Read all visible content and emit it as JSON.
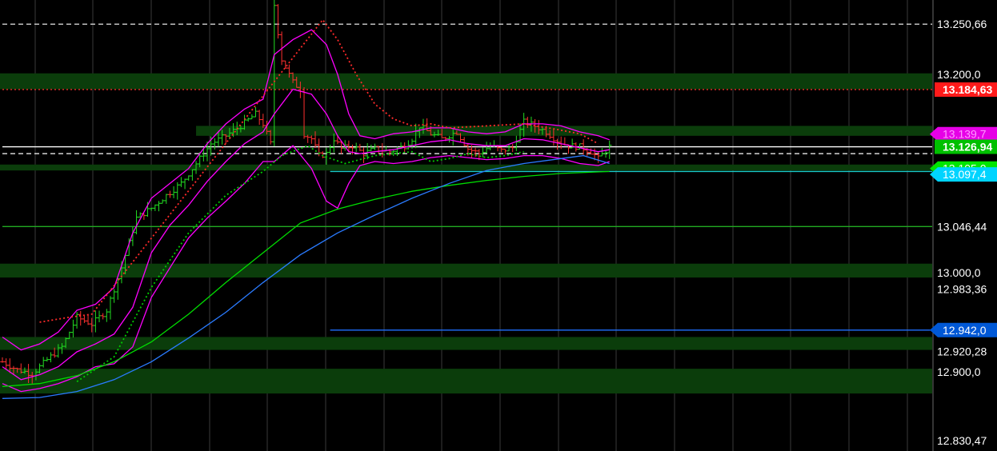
{
  "chart_data": {
    "type": "line",
    "theme": {
      "background": "#000000",
      "grid": "#3a3a3a",
      "zone_fill": "#0b3d0b",
      "axis_text": "#ffffff"
    },
    "ylim": [
      12820,
      13275
    ],
    "bar_count": 250,
    "price_bars_end_index": 163,
    "zones": [
      {
        "from": 13185,
        "to": 13201
      },
      {
        "from": 13138,
        "to": 13148,
        "start_index": 52
      },
      {
        "from": 13103,
        "to": 13109
      },
      {
        "from": 12995,
        "to": 13009
      },
      {
        "from": 12922,
        "to": 12935
      },
      {
        "from": 12878,
        "to": 12903
      }
    ],
    "levels": [
      {
        "value": 13250.66,
        "color": "#ffffff",
        "style": "dashed",
        "start_index": 0
      },
      {
        "value": 13184.63,
        "color": "#ff2a2a",
        "style": "dotted",
        "start_index": 0
      },
      {
        "value": 13126.94,
        "color": "#ffffff",
        "style": "solid",
        "start_index": 0
      },
      {
        "value": 13120.0,
        "color": "#ffffff",
        "style": "dashed",
        "start_index": 0
      },
      {
        "value": 13102.0,
        "color": "#19c9c9",
        "style": "solid",
        "start_index": 88
      },
      {
        "value": 13046.44,
        "color": "#22aa22",
        "style": "solid",
        "start_index": 0
      },
      {
        "value": 12942.0,
        "color": "#1f6fff",
        "style": "solid",
        "start_index": 88
      }
    ],
    "axis_labels": [
      {
        "text": "13.250,66",
        "value": 13250.66,
        "style": "plain"
      },
      {
        "text": "13.200,0",
        "value": 13200.0,
        "style": "plain"
      },
      {
        "text": "13.184,63",
        "value": 13184.63,
        "style": "badge",
        "bg": "#ff1a1a",
        "fg": "#ffffff"
      },
      {
        "text": "13.139,7",
        "value": 13139.7,
        "style": "tag",
        "bg": "#e600e6",
        "fg": "#ff99ff"
      },
      {
        "text": "13.126,94",
        "value": 13126.94,
        "style": "badge",
        "bg": "#00c000",
        "fg": "#ffffff"
      },
      {
        "text": "13.105,0",
        "value": 13105.0,
        "style": "tag",
        "bg": "#00e600",
        "fg": "#ffffff"
      },
      {
        "text": "13.097,4",
        "value": 13099.0,
        "style": "tag",
        "bg": "#00d4ff",
        "fg": "#ffffff"
      },
      {
        "text": "13.046,44",
        "value": 13046.44,
        "style": "plain"
      },
      {
        "text": "13.000,0",
        "value": 13000.0,
        "style": "plain"
      },
      {
        "text": "12.983,36",
        "value": 12983.36,
        "style": "plain"
      },
      {
        "text": "12.942,0",
        "value": 12942.0,
        "style": "tag",
        "bg": "#0058d6",
        "fg": "#ffffff"
      },
      {
        "text": "12.920,28",
        "value": 12920.28,
        "style": "plain"
      },
      {
        "text": "12.900,0",
        "value": 12900.0,
        "style": "plain"
      },
      {
        "text": "12.830,47",
        "value": 12830.47,
        "style": "plain"
      }
    ],
    "price_path": [
      [
        0,
        12910
      ],
      [
        4,
        12902
      ],
      [
        8,
        12898
      ],
      [
        12,
        12912
      ],
      [
        16,
        12925
      ],
      [
        20,
        12955
      ],
      [
        24,
        12948
      ],
      [
        28,
        12962
      ],
      [
        32,
        13005
      ],
      [
        36,
        13055
      ],
      [
        40,
        13065
      ],
      [
        44,
        13078
      ],
      [
        48,
        13090
      ],
      [
        52,
        13110
      ],
      [
        56,
        13130
      ],
      [
        60,
        13138
      ],
      [
        64,
        13148
      ],
      [
        68,
        13160
      ],
      [
        70,
        13150
      ],
      [
        72,
        13130
      ],
      [
        73,
        13270
      ],
      [
        75,
        13215
      ],
      [
        78,
        13192
      ],
      [
        80,
        13185
      ],
      [
        81,
        13140
      ],
      [
        83,
        13135
      ],
      [
        85,
        13118
      ],
      [
        87,
        13120
      ],
      [
        89,
        13135
      ],
      [
        91,
        13125
      ],
      [
        94,
        13128
      ],
      [
        97,
        13120
      ],
      [
        100,
        13125
      ],
      [
        104,
        13122
      ],
      [
        108,
        13128
      ],
      [
        110,
        13135
      ],
      [
        112,
        13148
      ],
      [
        115,
        13140
      ],
      [
        118,
        13135
      ],
      [
        122,
        13142
      ],
      [
        125,
        13125
      ],
      [
        128,
        13120
      ],
      [
        131,
        13128
      ],
      [
        134,
        13123
      ],
      [
        137,
        13126
      ],
      [
        140,
        13152
      ],
      [
        143,
        13148
      ],
      [
        146,
        13142
      ],
      [
        149,
        13133
      ],
      [
        152,
        13128
      ],
      [
        155,
        13127
      ],
      [
        158,
        13122
      ],
      [
        160,
        13115
      ],
      [
        163,
        13126.94
      ]
    ],
    "series": [
      {
        "color": "#ff00ff",
        "style": "solid",
        "points": [
          [
            0,
            12935
          ],
          [
            5,
            12922
          ],
          [
            10,
            12928
          ],
          [
            15,
            12940
          ],
          [
            20,
            12962
          ],
          [
            25,
            12968
          ],
          [
            30,
            12985
          ],
          [
            35,
            13040
          ],
          [
            40,
            13075
          ],
          [
            45,
            13090
          ],
          [
            50,
            13105
          ],
          [
            55,
            13130
          ],
          [
            60,
            13150
          ],
          [
            65,
            13165
          ],
          [
            70,
            13175
          ],
          [
            73,
            13220
          ],
          [
            78,
            13235
          ],
          [
            83,
            13245
          ],
          [
            87,
            13230
          ],
          [
            90,
            13200
          ],
          [
            93,
            13160
          ],
          [
            96,
            13138
          ],
          [
            100,
            13135
          ],
          [
            105,
            13140
          ],
          [
            110,
            13142
          ],
          [
            115,
            13146
          ],
          [
            120,
            13146
          ],
          [
            125,
            13142
          ],
          [
            130,
            13140
          ],
          [
            135,
            13142
          ],
          [
            140,
            13150
          ],
          [
            145,
            13150
          ],
          [
            150,
            13148
          ],
          [
            155,
            13142
          ],
          [
            160,
            13138
          ],
          [
            163,
            13134
          ]
        ]
      },
      {
        "color": "#ff00ff",
        "style": "solid",
        "points": [
          [
            0,
            12905
          ],
          [
            5,
            12892
          ],
          [
            10,
            12897
          ],
          [
            15,
            12905
          ],
          [
            20,
            12920
          ],
          [
            25,
            12928
          ],
          [
            30,
            12938
          ],
          [
            35,
            12965
          ],
          [
            40,
            13020
          ],
          [
            45,
            13048
          ],
          [
            50,
            13068
          ],
          [
            55,
            13092
          ],
          [
            60,
            13112
          ],
          [
            65,
            13130
          ],
          [
            70,
            13142
          ],
          [
            73,
            13160
          ],
          [
            78,
            13185
          ],
          [
            83,
            13180
          ],
          [
            87,
            13160
          ],
          [
            90,
            13138
          ],
          [
            93,
            13122
          ],
          [
            96,
            13120
          ],
          [
            100,
            13122
          ],
          [
            105,
            13124
          ],
          [
            110,
            13128
          ],
          [
            115,
            13132
          ],
          [
            120,
            13134
          ],
          [
            125,
            13130
          ],
          [
            130,
            13128
          ],
          [
            135,
            13128
          ],
          [
            140,
            13135
          ],
          [
            145,
            13134
          ],
          [
            150,
            13130
          ],
          [
            155,
            13126
          ],
          [
            160,
            13122
          ],
          [
            163,
            13124
          ]
        ]
      },
      {
        "color": "#ff00ff",
        "style": "solid",
        "points": [
          [
            0,
            12888
          ],
          [
            5,
            12880
          ],
          [
            10,
            12883
          ],
          [
            15,
            12888
          ],
          [
            20,
            12895
          ],
          [
            25,
            12905
          ],
          [
            30,
            12908
          ],
          [
            35,
            12925
          ],
          [
            40,
            12975
          ],
          [
            45,
            13005
          ],
          [
            50,
            13035
          ],
          [
            55,
            13055
          ],
          [
            60,
            13072
          ],
          [
            65,
            13090
          ],
          [
            70,
            13112
          ],
          [
            73,
            13112
          ],
          [
            78,
            13128
          ],
          [
            83,
            13105
          ],
          [
            87,
            13072
          ],
          [
            90,
            13065
          ],
          [
            93,
            13090
          ],
          [
            96,
            13108
          ],
          [
            100,
            13112
          ],
          [
            105,
            13110
          ],
          [
            110,
            13112
          ],
          [
            115,
            13116
          ],
          [
            120,
            13118
          ],
          [
            125,
            13116
          ],
          [
            130,
            13114
          ],
          [
            135,
            13115
          ],
          [
            140,
            13118
          ],
          [
            145,
            13118
          ],
          [
            150,
            13115
          ],
          [
            155,
            13110
          ],
          [
            160,
            13108
          ],
          [
            163,
            13112
          ]
        ]
      },
      {
        "color": "#00dd00",
        "style": "solid",
        "points": [
          [
            0,
            12885
          ],
          [
            10,
            12888
          ],
          [
            20,
            12896
          ],
          [
            30,
            12910
          ],
          [
            40,
            12930
          ],
          [
            50,
            12958
          ],
          [
            60,
            12990
          ],
          [
            70,
            13020
          ],
          [
            80,
            13050
          ],
          [
            90,
            13064
          ],
          [
            100,
            13074
          ],
          [
            110,
            13082
          ],
          [
            120,
            13088
          ],
          [
            130,
            13093
          ],
          [
            140,
            13097
          ],
          [
            150,
            13100
          ],
          [
            163,
            13102
          ]
        ]
      },
      {
        "color": "#2a7bff",
        "style": "solid",
        "points": [
          [
            0,
            12873
          ],
          [
            10,
            12874
          ],
          [
            20,
            12880
          ],
          [
            30,
            12892
          ],
          [
            40,
            12910
          ],
          [
            50,
            12934
          ],
          [
            60,
            12960
          ],
          [
            70,
            12990
          ],
          [
            80,
            13018
          ],
          [
            90,
            13040
          ],
          [
            100,
            13058
          ],
          [
            110,
            13075
          ],
          [
            120,
            13090
          ],
          [
            130,
            13103
          ],
          [
            140,
            13110
          ],
          [
            150,
            13115
          ],
          [
            156,
            13118
          ],
          [
            163,
            13110
          ]
        ]
      },
      {
        "color": "#00cc00",
        "style": "dotted",
        "points": [
          [
            20,
            12890
          ],
          [
            30,
            12915
          ],
          [
            40,
            12985
          ],
          [
            50,
            13040
          ],
          [
            60,
            13078
          ],
          [
            70,
            13102
          ],
          [
            75,
            13118
          ],
          [
            82,
            13128
          ],
          [
            86,
            13118
          ],
          [
            92,
            13110
          ],
          [
            100,
            13118
          ],
          [
            110,
            13122
          ],
          [
            115,
            13112
          ],
          [
            120,
            13115
          ],
          [
            125,
            13120
          ],
          [
            130,
            13116
          ],
          [
            135,
            13118
          ],
          [
            140,
            13122
          ]
        ]
      },
      {
        "color": "#ff2a2a",
        "style": "dotted",
        "points": [
          [
            10,
            12950
          ],
          [
            18,
            12955
          ],
          [
            24,
            12958
          ],
          [
            86,
            13255
          ],
          [
            90,
            13235
          ],
          [
            95,
            13200
          ],
          [
            100,
            13170
          ],
          [
            105,
            13155
          ],
          [
            110,
            13148
          ],
          [
            115,
            13150
          ],
          [
            120,
            13146
          ],
          [
            140,
            13150
          ],
          [
            148,
            13145
          ],
          [
            155,
            13140
          ],
          [
            160,
            13130
          ]
        ]
      }
    ]
  }
}
